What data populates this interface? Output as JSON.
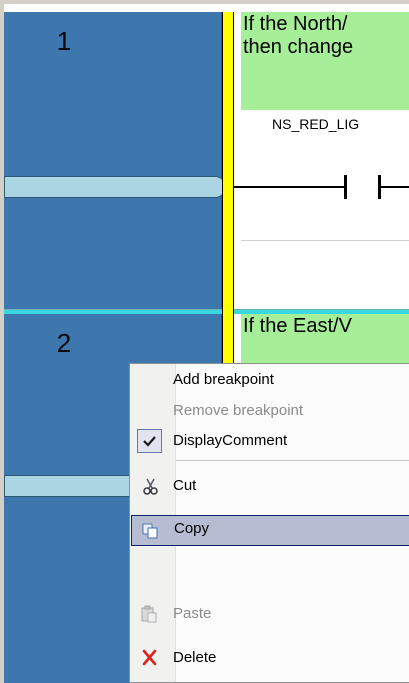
{
  "rungs": [
    {
      "number": "1",
      "comment_lines": [
        "If the North/",
        "then change"
      ],
      "variable": "NS_RED_LIG"
    },
    {
      "number": "2",
      "comment_lines": [
        "If the East/V"
      ]
    }
  ],
  "context_menu": {
    "items": [
      {
        "id": "add_breakpoint",
        "label": "Add breakpoint",
        "enabled": true,
        "icon": null
      },
      {
        "id": "remove_breakpoint",
        "label": "Remove breakpoint",
        "enabled": false,
        "icon": null
      },
      {
        "id": "display_comment",
        "label": "DisplayComment",
        "enabled": true,
        "checked": true,
        "icon": "checkmark-icon"
      },
      {
        "id": "cut",
        "label": "Cut",
        "enabled": true,
        "icon": "scissors-icon"
      },
      {
        "id": "copy",
        "label": "Copy",
        "enabled": true,
        "highlighted": true,
        "icon": "copy-icon"
      },
      {
        "id": "paste",
        "label": "Paste",
        "enabled": false,
        "icon": "paste-icon"
      },
      {
        "id": "delete",
        "label": "Delete",
        "enabled": true,
        "icon": "delete-x-icon"
      }
    ]
  },
  "colors": {
    "rung_number_bg": "#3e77ad",
    "power_rail": "#ffff00",
    "comment_bg": "#a7ee98",
    "rung_separator": "#39d7e2",
    "menu_highlight": "#b6bdd2",
    "delete_icon": "#e0201c"
  }
}
